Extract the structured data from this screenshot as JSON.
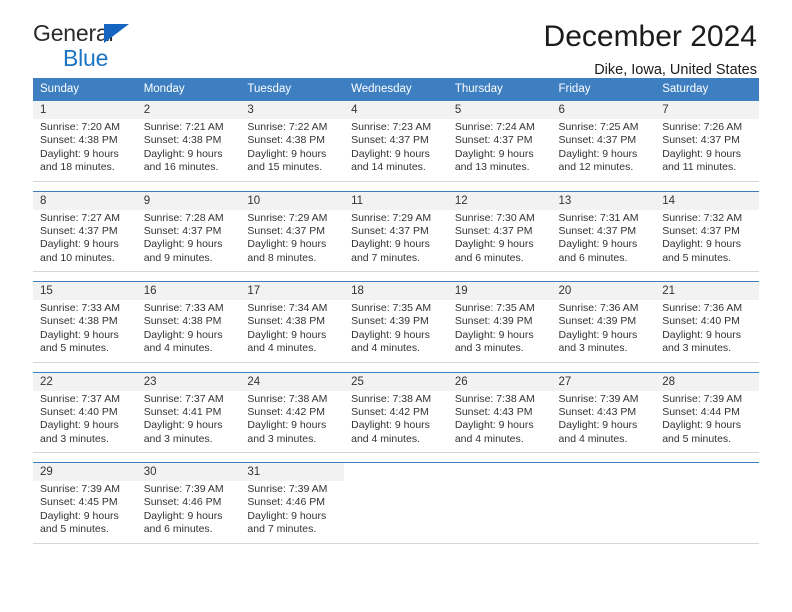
{
  "brand": {
    "name_top": "General",
    "name_bottom": "Blue",
    "triangle_color": "#1565c0",
    "text_color_bottom": "#1b74c4"
  },
  "header": {
    "title": "December 2024",
    "subtitle": "Dike, Iowa, United States"
  },
  "theme": {
    "header_blue": "#3d7fc1",
    "daynum_bg": "#f2f2f2",
    "cell_border": "#d6d6d6"
  },
  "weekday_headers": [
    "Sunday",
    "Monday",
    "Tuesday",
    "Wednesday",
    "Thursday",
    "Friday",
    "Saturday"
  ],
  "weeks": [
    {
      "days": [
        {
          "num": "1",
          "sunrise": "Sunrise: 7:20 AM",
          "sunset": "Sunset: 4:38 PM",
          "daylight1": "Daylight: 9 hours",
          "daylight2": "and 18 minutes."
        },
        {
          "num": "2",
          "sunrise": "Sunrise: 7:21 AM",
          "sunset": "Sunset: 4:38 PM",
          "daylight1": "Daylight: 9 hours",
          "daylight2": "and 16 minutes."
        },
        {
          "num": "3",
          "sunrise": "Sunrise: 7:22 AM",
          "sunset": "Sunset: 4:38 PM",
          "daylight1": "Daylight: 9 hours",
          "daylight2": "and 15 minutes."
        },
        {
          "num": "4",
          "sunrise": "Sunrise: 7:23 AM",
          "sunset": "Sunset: 4:37 PM",
          "daylight1": "Daylight: 9 hours",
          "daylight2": "and 14 minutes."
        },
        {
          "num": "5",
          "sunrise": "Sunrise: 7:24 AM",
          "sunset": "Sunset: 4:37 PM",
          "daylight1": "Daylight: 9 hours",
          "daylight2": "and 13 minutes."
        },
        {
          "num": "6",
          "sunrise": "Sunrise: 7:25 AM",
          "sunset": "Sunset: 4:37 PM",
          "daylight1": "Daylight: 9 hours",
          "daylight2": "and 12 minutes."
        },
        {
          "num": "7",
          "sunrise": "Sunrise: 7:26 AM",
          "sunset": "Sunset: 4:37 PM",
          "daylight1": "Daylight: 9 hours",
          "daylight2": "and 11 minutes."
        }
      ]
    },
    {
      "days": [
        {
          "num": "8",
          "sunrise": "Sunrise: 7:27 AM",
          "sunset": "Sunset: 4:37 PM",
          "daylight1": "Daylight: 9 hours",
          "daylight2": "and 10 minutes."
        },
        {
          "num": "9",
          "sunrise": "Sunrise: 7:28 AM",
          "sunset": "Sunset: 4:37 PM",
          "daylight1": "Daylight: 9 hours",
          "daylight2": "and 9 minutes."
        },
        {
          "num": "10",
          "sunrise": "Sunrise: 7:29 AM",
          "sunset": "Sunset: 4:37 PM",
          "daylight1": "Daylight: 9 hours",
          "daylight2": "and 8 minutes."
        },
        {
          "num": "11",
          "sunrise": "Sunrise: 7:29 AM",
          "sunset": "Sunset: 4:37 PM",
          "daylight1": "Daylight: 9 hours",
          "daylight2": "and 7 minutes."
        },
        {
          "num": "12",
          "sunrise": "Sunrise: 7:30 AM",
          "sunset": "Sunset: 4:37 PM",
          "daylight1": "Daylight: 9 hours",
          "daylight2": "and 6 minutes."
        },
        {
          "num": "13",
          "sunrise": "Sunrise: 7:31 AM",
          "sunset": "Sunset: 4:37 PM",
          "daylight1": "Daylight: 9 hours",
          "daylight2": "and 6 minutes."
        },
        {
          "num": "14",
          "sunrise": "Sunrise: 7:32 AM",
          "sunset": "Sunset: 4:37 PM",
          "daylight1": "Daylight: 9 hours",
          "daylight2": "and 5 minutes."
        }
      ]
    },
    {
      "days": [
        {
          "num": "15",
          "sunrise": "Sunrise: 7:33 AM",
          "sunset": "Sunset: 4:38 PM",
          "daylight1": "Daylight: 9 hours",
          "daylight2": "and 5 minutes."
        },
        {
          "num": "16",
          "sunrise": "Sunrise: 7:33 AM",
          "sunset": "Sunset: 4:38 PM",
          "daylight1": "Daylight: 9 hours",
          "daylight2": "and 4 minutes."
        },
        {
          "num": "17",
          "sunrise": "Sunrise: 7:34 AM",
          "sunset": "Sunset: 4:38 PM",
          "daylight1": "Daylight: 9 hours",
          "daylight2": "and 4 minutes."
        },
        {
          "num": "18",
          "sunrise": "Sunrise: 7:35 AM",
          "sunset": "Sunset: 4:39 PM",
          "daylight1": "Daylight: 9 hours",
          "daylight2": "and 4 minutes."
        },
        {
          "num": "19",
          "sunrise": "Sunrise: 7:35 AM",
          "sunset": "Sunset: 4:39 PM",
          "daylight1": "Daylight: 9 hours",
          "daylight2": "and 3 minutes."
        },
        {
          "num": "20",
          "sunrise": "Sunrise: 7:36 AM",
          "sunset": "Sunset: 4:39 PM",
          "daylight1": "Daylight: 9 hours",
          "daylight2": "and 3 minutes."
        },
        {
          "num": "21",
          "sunrise": "Sunrise: 7:36 AM",
          "sunset": "Sunset: 4:40 PM",
          "daylight1": "Daylight: 9 hours",
          "daylight2": "and 3 minutes."
        }
      ]
    },
    {
      "days": [
        {
          "num": "22",
          "sunrise": "Sunrise: 7:37 AM",
          "sunset": "Sunset: 4:40 PM",
          "daylight1": "Daylight: 9 hours",
          "daylight2": "and 3 minutes."
        },
        {
          "num": "23",
          "sunrise": "Sunrise: 7:37 AM",
          "sunset": "Sunset: 4:41 PM",
          "daylight1": "Daylight: 9 hours",
          "daylight2": "and 3 minutes."
        },
        {
          "num": "24",
          "sunrise": "Sunrise: 7:38 AM",
          "sunset": "Sunset: 4:42 PM",
          "daylight1": "Daylight: 9 hours",
          "daylight2": "and 3 minutes."
        },
        {
          "num": "25",
          "sunrise": "Sunrise: 7:38 AM",
          "sunset": "Sunset: 4:42 PM",
          "daylight1": "Daylight: 9 hours",
          "daylight2": "and 4 minutes."
        },
        {
          "num": "26",
          "sunrise": "Sunrise: 7:38 AM",
          "sunset": "Sunset: 4:43 PM",
          "daylight1": "Daylight: 9 hours",
          "daylight2": "and 4 minutes."
        },
        {
          "num": "27",
          "sunrise": "Sunrise: 7:39 AM",
          "sunset": "Sunset: 4:43 PM",
          "daylight1": "Daylight: 9 hours",
          "daylight2": "and 4 minutes."
        },
        {
          "num": "28",
          "sunrise": "Sunrise: 7:39 AM",
          "sunset": "Sunset: 4:44 PM",
          "daylight1": "Daylight: 9 hours",
          "daylight2": "and 5 minutes."
        }
      ]
    },
    {
      "days": [
        {
          "num": "29",
          "sunrise": "Sunrise: 7:39 AM",
          "sunset": "Sunset: 4:45 PM",
          "daylight1": "Daylight: 9 hours",
          "daylight2": "and 5 minutes."
        },
        {
          "num": "30",
          "sunrise": "Sunrise: 7:39 AM",
          "sunset": "Sunset: 4:46 PM",
          "daylight1": "Daylight: 9 hours",
          "daylight2": "and 6 minutes."
        },
        {
          "num": "31",
          "sunrise": "Sunrise: 7:39 AM",
          "sunset": "Sunset: 4:46 PM",
          "daylight1": "Daylight: 9 hours",
          "daylight2": "and 7 minutes."
        },
        {
          "num": "",
          "sunrise": "",
          "sunset": "",
          "daylight1": "",
          "daylight2": ""
        },
        {
          "num": "",
          "sunrise": "",
          "sunset": "",
          "daylight1": "",
          "daylight2": ""
        },
        {
          "num": "",
          "sunrise": "",
          "sunset": "",
          "daylight1": "",
          "daylight2": ""
        },
        {
          "num": "",
          "sunrise": "",
          "sunset": "",
          "daylight1": "",
          "daylight2": ""
        }
      ]
    }
  ]
}
